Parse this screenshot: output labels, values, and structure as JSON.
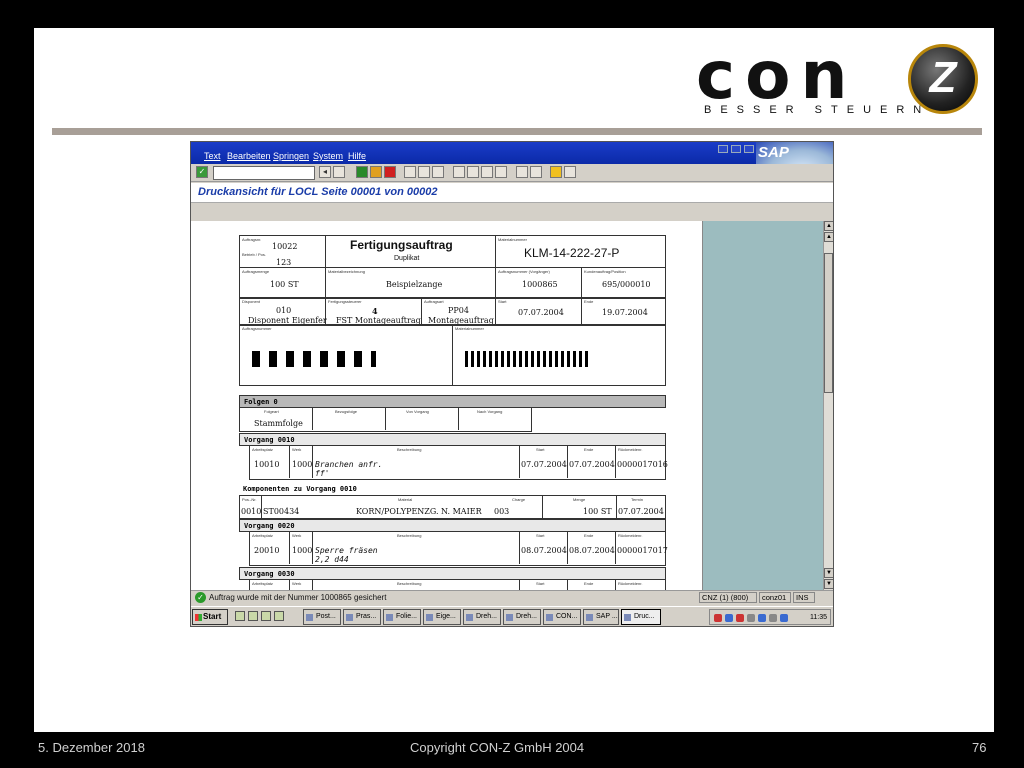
{
  "brand": {
    "word": "con",
    "mark": "Z",
    "tagline": "BESSER STEUERN"
  },
  "sap": {
    "menu": [
      "Text",
      "Bearbeiten",
      "Springen",
      "System",
      "Hilfe"
    ],
    "logo": "SAP",
    "title": "Druckansicht für LOCL Seite 00001 von 00002"
  },
  "doc": {
    "header": {
      "auftragsnr_label": "Auftragsnr.",
      "auftragsnr": "10022",
      "betrieb_label": "Betrieb / Pos.",
      "betrieb": "123",
      "title": "Fertigungsauftrag",
      "subtitle": "Duplikat",
      "material_label": "Materialnummer",
      "material": "KLM-14-222-27-P"
    },
    "row2": {
      "menge_label": "Auftragsmenge",
      "menge": "100 ST",
      "bez_label": "Materialbezeichnung",
      "bez": "Beispielzange",
      "kundenauftrag_label": "Auftragsnummer (Vorgänger)",
      "kundenauftrag": "1000865",
      "kunde_label": "Kundenauftrag/Position",
      "kunde": "695/000010"
    },
    "row3": {
      "disponent_label": "Disponent",
      "disponent_nr": "010",
      "disponent": "Disponent Eigenfer",
      "fst_label": "Fertigungssteuerer",
      "fst_nr": "4",
      "fst": "FST Montageauftrag",
      "art_label": "Auftragsart",
      "art_nr": "PP04",
      "art": "Montageauftrag",
      "start_label": "Start",
      "start": "07.07.2004",
      "ende_label": "Ende",
      "ende": "19.07.2004"
    },
    "barcode1_label": "Auftragsnummer",
    "barcode2_label": "Materialnummer",
    "folgen": {
      "head": "Folgen 0",
      "cols": [
        "Folgeart",
        "Bezugsfolge",
        "Von Vorgang",
        "Nach Vorgang"
      ],
      "folgeart": "Stammfolge"
    },
    "op_cols": [
      "Arbeitsplatz",
      "Werk",
      "Beschreibung",
      "Start",
      "Ende",
      "Rückmeldenr."
    ],
    "vorgang1": {
      "head": "Vorgang 0010",
      "arbeitsplatz": "10010",
      "werk": "1000",
      "beschr1": "Branchen anfr.",
      "beschr2": "ff'",
      "start": "07.07.2004",
      "ende": "07.07.2004",
      "rueck": "0000017016"
    },
    "komponenten": {
      "head": "Komponenten zu Vorgang 0010",
      "cols": [
        "Pos.-Nr.",
        "Material",
        "Charge",
        "Menge",
        "Termin"
      ],
      "pos": "0010",
      "material": "ST00434",
      "bez": "KORN/POLYPENZG. N. MAIER",
      "charge": "003",
      "menge": "100 ST",
      "termin": "07.07.2004"
    },
    "vorgang2": {
      "head": "Vorgang 0020",
      "arbeitsplatz": "20010",
      "werk": "1000",
      "beschr1": "Sperre fräsen",
      "beschr2": "2,2 d44",
      "start": "08.07.2004",
      "ende": "08.07.2004",
      "rueck": "0000017017"
    },
    "vorgang3": {
      "head": "Vorgang 0030"
    }
  },
  "status": {
    "message": "Auftrag wurde mit der Nummer 1000865 gesichert",
    "system": "CNZ (1) (800)",
    "user": "conz01",
    "mode": "INS"
  },
  "taskbar": {
    "start": "Start",
    "tasks": [
      "Post...",
      "Pras...",
      "Folie...",
      "Eige...",
      "Dreh...",
      "Dreh...",
      "CON...",
      "SAP ...",
      "Druc..."
    ],
    "clock": "11:35"
  },
  "footer": {
    "date": "5. Dezember 2018",
    "copyright": "Copyright CON-Z GmbH 2004",
    "page": "76"
  }
}
